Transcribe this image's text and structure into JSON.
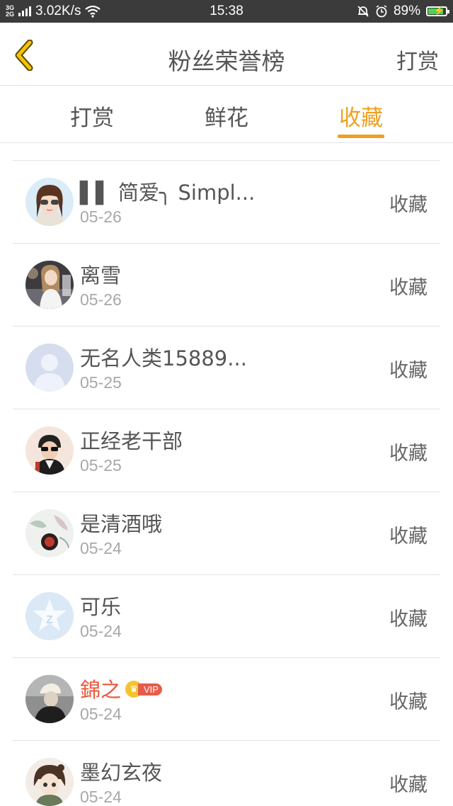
{
  "status_bar": {
    "network": "3G 2G",
    "speed": "3.02K/s",
    "time": "15:38",
    "battery": "89%",
    "battery_level": 0.89
  },
  "header": {
    "title": "粉丝荣誉榜",
    "action": "打赏"
  },
  "tabs": [
    {
      "label": "打赏",
      "active": false
    },
    {
      "label": "鲜花",
      "active": false
    },
    {
      "label": "收藏",
      "active": true
    }
  ],
  "colors": {
    "accent": "#f0a020",
    "vip_name": "#e8573c",
    "status_bar": "#3b3b3b"
  },
  "list": [
    {
      "name": "▌▌ 简爱╮ Simpl...",
      "date": "05-26",
      "action": "收藏",
      "avatar": "cartoon-girl-sunglasses",
      "vip": false
    },
    {
      "name": "离雪",
      "date": "05-26",
      "action": "收藏",
      "avatar": "photo-girl",
      "vip": false
    },
    {
      "name": "无名人类15889...",
      "date": "05-25",
      "action": "收藏",
      "avatar": "default-person",
      "vip": false
    },
    {
      "name": "正经老干部",
      "date": "05-25",
      "action": "收藏",
      "avatar": "photo-boy-sunglasses",
      "vip": false
    },
    {
      "name": "是清酒哦",
      "date": "05-24",
      "action": "收藏",
      "avatar": "painting-flower",
      "vip": false
    },
    {
      "name": "可乐",
      "date": "05-24",
      "action": "收藏",
      "avatar": "qq-star",
      "vip": false
    },
    {
      "name": "錦之",
      "date": "05-24",
      "action": "收藏",
      "avatar": "photo-hat-person",
      "vip": true,
      "vip_label": "VIP"
    },
    {
      "name": "墨幻玄夜",
      "date": "05-24",
      "action": "收藏",
      "avatar": "anime-character",
      "vip": false
    }
  ]
}
